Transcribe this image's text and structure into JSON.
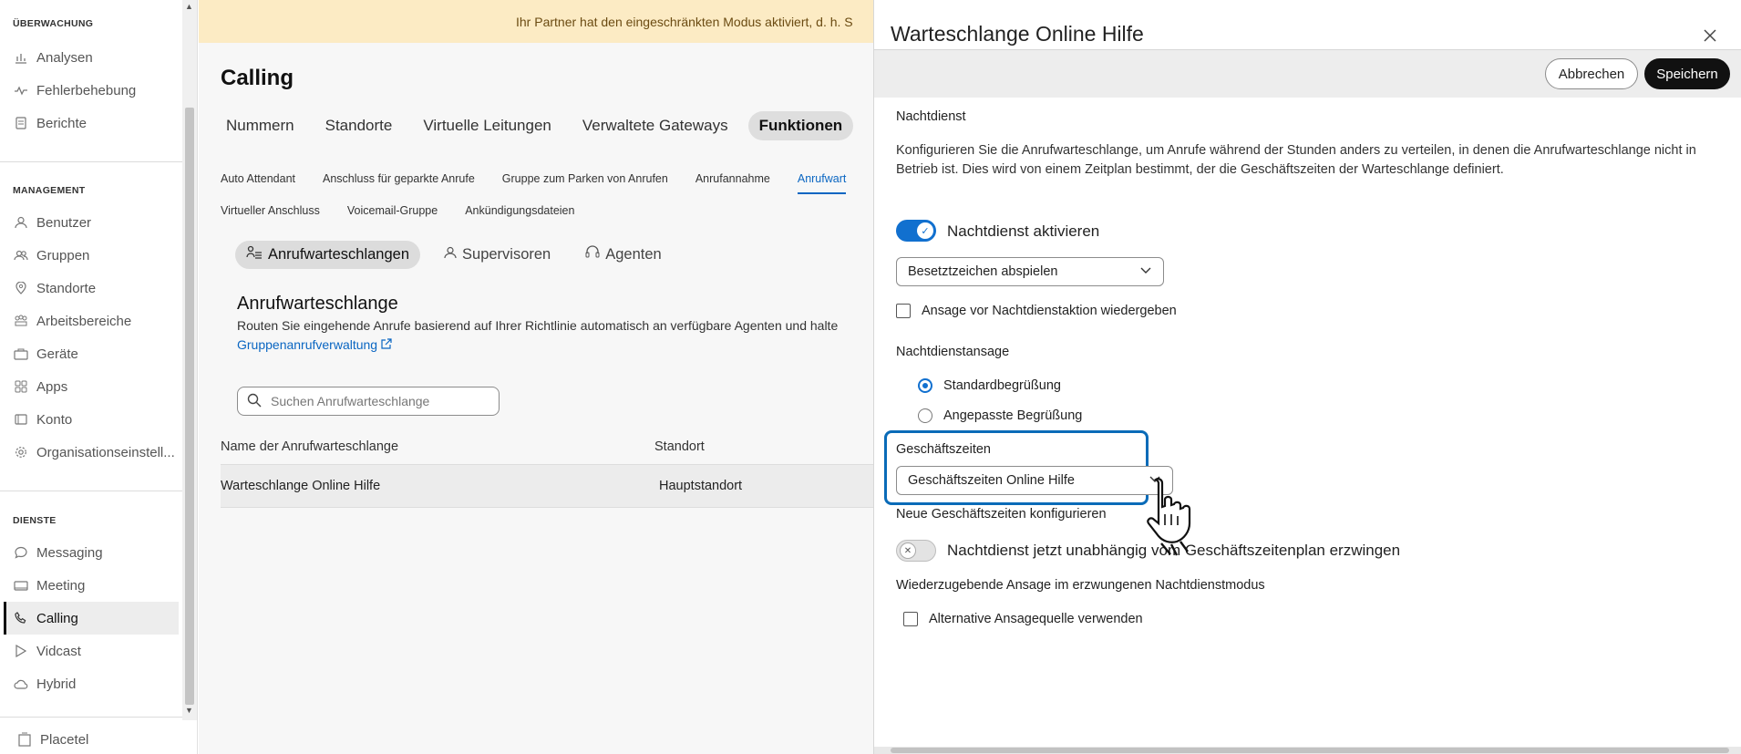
{
  "sidebar": {
    "sections": {
      "monitoring": "ÜBERWACHUNG",
      "management": "MANAGEMENT",
      "services": "DIENSTE"
    },
    "items": {
      "analysen": "Analysen",
      "fehlerbehebung": "Fehlerbehebung",
      "berichte": "Berichte",
      "benutzer": "Benutzer",
      "gruppen": "Gruppen",
      "standorte": "Standorte",
      "arbeitsbereiche": "Arbeitsbereiche",
      "geraete": "Geräte",
      "apps": "Apps",
      "konto": "Konto",
      "organisation": "Organisationseinstell...",
      "messaging": "Messaging",
      "meeting": "Meeting",
      "calling": "Calling",
      "vidcast": "Vidcast",
      "hybrid": "Hybrid"
    },
    "footer": "Placetel"
  },
  "main": {
    "banner": "Ihr Partner hat den eingeschränkten Modus aktiviert, d. h. S",
    "title": "Calling",
    "tabs": {
      "nummern": "Nummern",
      "standorte": "Standorte",
      "virtuelle": "Virtuelle Leitungen",
      "gateways": "Verwaltete Gateways",
      "funktionen": "Funktionen"
    },
    "subtabs_row1": {
      "auto": "Auto Attendant",
      "geparkt": "Anschluss für geparkte Anrufe",
      "parken": "Gruppe zum Parken von Anrufen",
      "annahme": "Anrufannahme",
      "warteschlange": "Anrufwart"
    },
    "subtabs_row2": {
      "virtuell": "Virtueller Anschluss",
      "voicemail": "Voicemail-Gruppe",
      "ankuendigung": "Ankündigungsdateien"
    },
    "pills": {
      "queues": "Anrufwarteschlangen",
      "supervisors": "Supervisoren",
      "agents": "Agenten"
    },
    "section_title": "Anrufwarteschlange",
    "section_desc": "Routen Sie eingehende Anrufe basierend auf Ihrer Richtlinie automatisch an verfügbare Agenten und halte",
    "section_link": "Gruppenanrufverwaltung",
    "search_placeholder": "Suchen Anrufwarteschlange",
    "table": {
      "col_name": "Name der Anrufwarteschlange",
      "col_location": "Standort",
      "rows": [
        {
          "name": "Warteschlange Online Hilfe",
          "location": "Hauptstandort"
        }
      ]
    }
  },
  "panel": {
    "title": "Warteschlange Online Hilfe",
    "cancel_label": "Abbrechen",
    "save_label": "Speichern",
    "night_service_label": "Nachtdienst",
    "night_service_desc": "Konfigurieren Sie die Anrufwarteschlange, um Anrufe während der Stunden anders zu verteilen, in denen die Anrufwarteschlange nicht in Betrieb ist. Dies wird von einem Zeitplan bestimmt, der die Geschäftszeiten der Warteschlange definiert.",
    "enable_toggle_label": "Nachtdienst aktivieren",
    "action_select_value": "Besetztzeichen abspielen",
    "announce_checkbox_label": "Ansage vor Nachtdienstaktion wiedergeben",
    "announcement_label": "Nachtdienstansage",
    "radio_default": "Standardbegrüßung",
    "radio_custom": "Angepasste Begrüßung",
    "business_hours_label": "Geschäftszeiten",
    "business_hours_value": "Geschäftszeiten Online Hilfe",
    "configure_link": "Neue Geschäftszeiten konfigurieren",
    "force_toggle_label": "Nachtdienst jetzt unabhängig vom Geschäftszeitenplan erzwingen",
    "forced_announce_label": "Wiederzugebende Ansage im erzwungenen Nachtdienstmodus",
    "alt_source_label": "Alternative Ansagequelle verwenden"
  },
  "colors": {
    "accent": "#1170cf",
    "banner_bg": "#fcebc4",
    "focus": "#0a6bb8"
  }
}
